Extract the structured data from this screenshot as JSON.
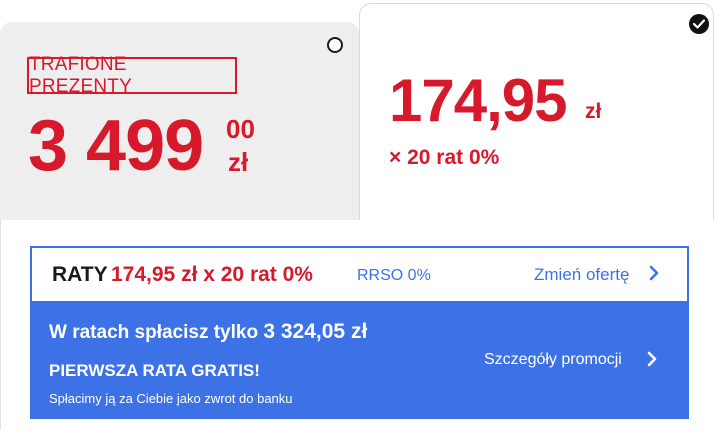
{
  "offer_cash": {
    "badge": "TRAFIONE PREZENTY",
    "price_main": "3 499",
    "price_cents": "00",
    "currency": "zł",
    "selected": false
  },
  "offer_installments": {
    "amount": "174,95",
    "currency": "zł",
    "count": "× 20 rat 0%",
    "selected": true
  },
  "installment_bar": {
    "label": "RATY",
    "offer": "174,95 zł x 20 rat 0%",
    "rrso": "RRSO 0%",
    "change_link": "Zmień ofertę"
  },
  "promo": {
    "total_text": "W ratach spłacisz tylko",
    "total_amount": "3 324,05 zł",
    "first_free": "PIERWSZA RATA GRATIS!",
    "refund_note": "Spłacimy ją za Ciebie jako zwrot do banku",
    "details_link": "Szczegóły promocji"
  },
  "colors": {
    "red": "#d7192c",
    "blue": "#3d72e6",
    "card_grey": "#eeeeee"
  },
  "icons": [
    "radio-unselected-icon",
    "radio-selected-check-icon",
    "chevron-right-icon"
  ]
}
